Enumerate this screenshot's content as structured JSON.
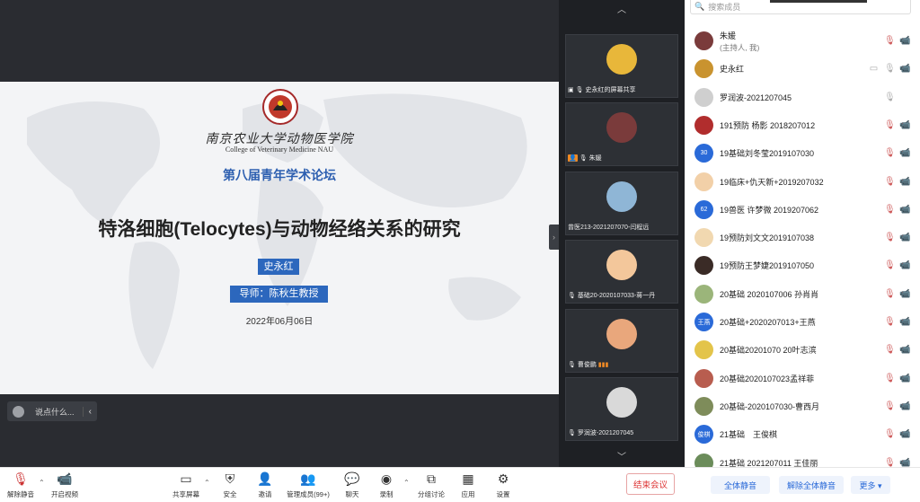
{
  "slide": {
    "university_cn": "南京农业大学动物医学院",
    "university_en": "College of Veterinary Medicine NAU",
    "forum": "第八届青年学术论坛",
    "title": "特洛细胞(Telocytes)与动物经络关系的研究",
    "presenter": "史永红",
    "advisor": "导师：陈秋生教授",
    "date": "2022年06月06日"
  },
  "chat": {
    "placeholder": "说点什么...",
    "collapse": "‹"
  },
  "strip": {
    "up": "︿",
    "down": "﹀",
    "tiles": [
      {
        "caption": "史永红的屏幕共享",
        "avatar_color": "#e8b73a"
      },
      {
        "caption": "朱媛",
        "avatar_color": "#7a3b3b"
      },
      {
        "caption": "曾医213-2021207070-闫程远",
        "avatar_color": "#8fb6d6"
      },
      {
        "caption": "基础20-2020107033-蒋一丹",
        "avatar_color": "#f3c79b"
      },
      {
        "caption": "曹俊鹏",
        "avatar_color": "#e9a77c"
      },
      {
        "caption": "罗润波-2021207045",
        "avatar_color": "#d9d9d9"
      }
    ]
  },
  "panel": {
    "search_placeholder": "搜索成员",
    "participants": [
      {
        "name": "朱媛",
        "sub": "(主持人, 我)",
        "avatar": "",
        "color": "#7a3b3b"
      },
      {
        "name": "史永红",
        "sub": "",
        "avatar": "",
        "color": "#c9932f"
      },
      {
        "name": "罗润波-2021207045",
        "sub": "",
        "avatar": "",
        "color": "#cfcfcf"
      },
      {
        "name": "191预防 杨影 2018207012",
        "sub": "",
        "avatar": "",
        "color": "#b12d2d"
      },
      {
        "name": "19基础刘冬莹2019107030",
        "sub": "",
        "avatar": "30",
        "color": "#2a6ad8"
      },
      {
        "name": "19临床+仇天新+2019207032",
        "sub": "",
        "avatar": "",
        "color": "#f2d0a8"
      },
      {
        "name": "19兽医 许梦微 2019207062",
        "sub": "",
        "avatar": "62",
        "color": "#2a6ad8"
      },
      {
        "name": "19预防刘文文2019107038",
        "sub": "",
        "avatar": "",
        "color": "#f1d8b0"
      },
      {
        "name": "19预防王梦婕2019107050",
        "sub": "",
        "avatar": "",
        "color": "#3a2b26"
      },
      {
        "name": "20基础 2020107006 孙肖肖",
        "sub": "",
        "avatar": "",
        "color": "#9bb57a"
      },
      {
        "name": "20基础+2020207013+王燕",
        "sub": "",
        "avatar": "王燕",
        "color": "#2a6ad8"
      },
      {
        "name": "20基础20201070 20叶志滨",
        "sub": "",
        "avatar": "",
        "color": "#e3c44a"
      },
      {
        "name": "20基础2020107023孟祥菲",
        "sub": "",
        "avatar": "",
        "color": "#b85d4f"
      },
      {
        "name": "20基础-2020107030-曹西月",
        "sub": "",
        "avatar": "",
        "color": "#7e8c5a"
      },
      {
        "name": "21基础　王俊棋",
        "sub": "",
        "avatar": "俊棋",
        "color": "#2a6ad8"
      },
      {
        "name": "21基础 2021207011 王佳丽",
        "sub": "",
        "avatar": "",
        "color": "#6b8c5a"
      }
    ],
    "mute_all": "全体静音",
    "unmute_all": "解除全体静音",
    "more": "更多 ▾"
  },
  "toolbar": {
    "unmute": "解除静音",
    "start_video": "开启视频",
    "share_screen": "共享屏幕",
    "security": "安全",
    "invite": "邀请",
    "manage": "管理成员(99+)",
    "chat": "聊天",
    "record": "录制",
    "breakout": "分组讨论",
    "apps": "应用",
    "settings": "设置",
    "end": "结束会议"
  }
}
